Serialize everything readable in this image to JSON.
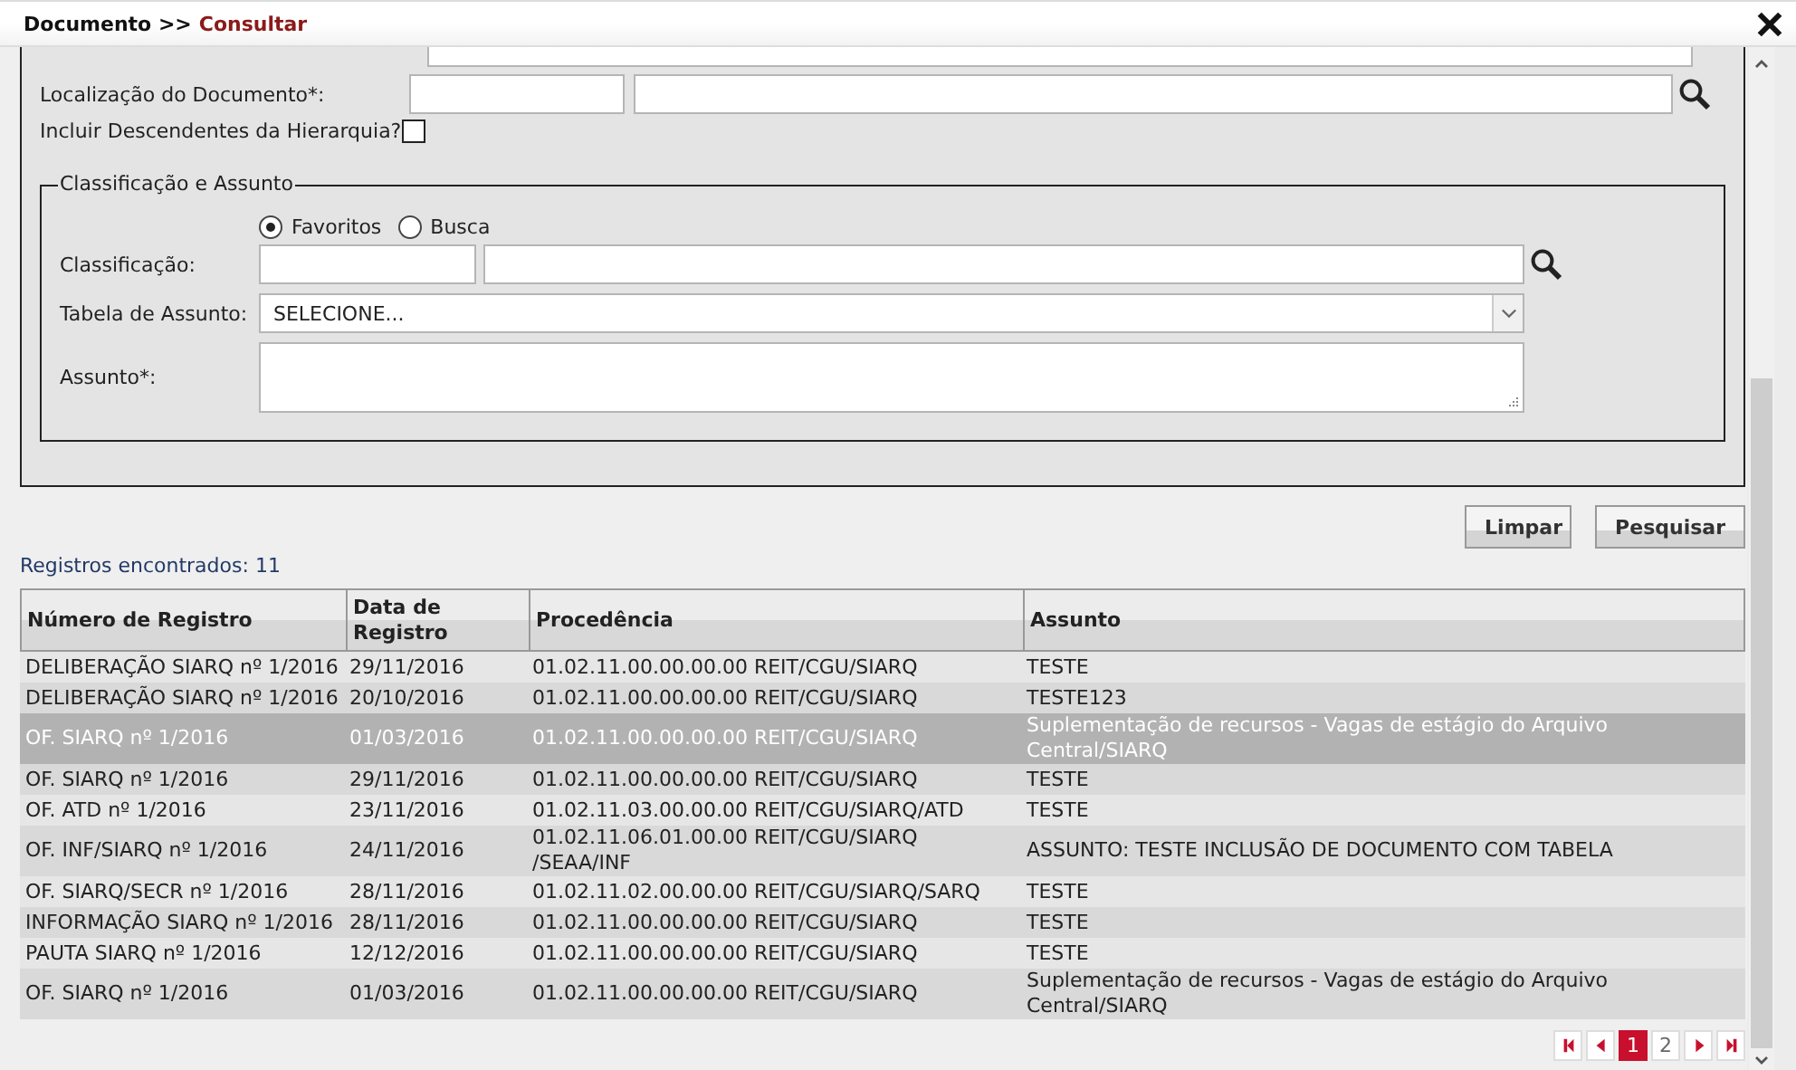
{
  "header": {
    "path": "Documento >>",
    "current": "Consultar"
  },
  "form": {
    "location_label": "Localização do Documento*:",
    "descendants": {
      "label": "Incluir Descendentes da Hierarquia?",
      "checked": false
    },
    "group": {
      "legend": "Classificação e Assunto",
      "radios": [
        {
          "label": "Favoritos",
          "selected": true
        },
        {
          "label": "Busca",
          "selected": false
        }
      ],
      "classification_label": "Classificação:",
      "table_label": "Tabela de Assunto:",
      "table_value": "SELECIONE...",
      "subject_label": "Assunto*:"
    }
  },
  "buttons": [
    "Limpar",
    "Pesquisar"
  ],
  "results_count": "Registros encontrados: 11",
  "table": {
    "columns": [
      "Número de Registro",
      "Data de Registro",
      "Procedência",
      "Assunto"
    ],
    "rows": [
      {
        "cells": [
          "DELIBERAÇÃO SIARQ nº 1/2016",
          "29/11/2016",
          "01.02.11.00.00.00.00 REIT/CGU/SIARQ",
          "TESTE"
        ],
        "selected": false
      },
      {
        "cells": [
          "DELIBERAÇÃO SIARQ nº 1/2016",
          "20/10/2016",
          "01.02.11.00.00.00.00 REIT/CGU/SIARQ",
          "TESTE123"
        ],
        "selected": false
      },
      {
        "cells": [
          "OF. SIARQ nº 1/2016",
          "01/03/2016",
          "01.02.11.00.00.00.00 REIT/CGU/SIARQ",
          "Suplementação de recursos - Vagas de estágio do Arquivo Central/SIARQ"
        ],
        "selected": true
      },
      {
        "cells": [
          "OF. SIARQ nº 1/2016",
          "29/11/2016",
          "01.02.11.00.00.00.00 REIT/CGU/SIARQ",
          "TESTE"
        ],
        "selected": false
      },
      {
        "cells": [
          "OF. ATD nº 1/2016",
          "23/11/2016",
          "01.02.11.03.00.00.00 REIT/CGU/SIARQ/ATD",
          "TESTE"
        ],
        "selected": false
      },
      {
        "cells": [
          "OF. INF/SIARQ nº 1/2016",
          "24/11/2016",
          "01.02.11.06.01.00.00 REIT/CGU/SIARQ /SEAA/INF",
          "ASSUNTO: TESTE INCLUSÃO DE DOCUMENTO COM TABELA"
        ],
        "selected": false
      },
      {
        "cells": [
          "OF. SIARQ/SECR nº 1/2016",
          "28/11/2016",
          "01.02.11.02.00.00.00 REIT/CGU/SIARQ/SARQ",
          "TESTE"
        ],
        "selected": false
      },
      {
        "cells": [
          "INFORMAÇÃO SIARQ nº 1/2016",
          "28/11/2016",
          "01.02.11.00.00.00.00 REIT/CGU/SIARQ",
          "TESTE"
        ],
        "selected": false
      },
      {
        "cells": [
          "PAUTA SIARQ nº 1/2016",
          "12/12/2016",
          "01.02.11.00.00.00.00 REIT/CGU/SIARQ",
          "TESTE"
        ],
        "selected": false
      },
      {
        "cells": [
          "OF. SIARQ nº 1/2016",
          "01/03/2016",
          "01.02.11.00.00.00.00 REIT/CGU/SIARQ",
          "Suplementação de recursos - Vagas de estágio do Arquivo Central/SIARQ"
        ],
        "selected": false
      }
    ]
  },
  "pagination": {
    "pages": [
      {
        "label": "1",
        "selected": true
      },
      {
        "label": "2",
        "selected": false
      }
    ]
  }
}
